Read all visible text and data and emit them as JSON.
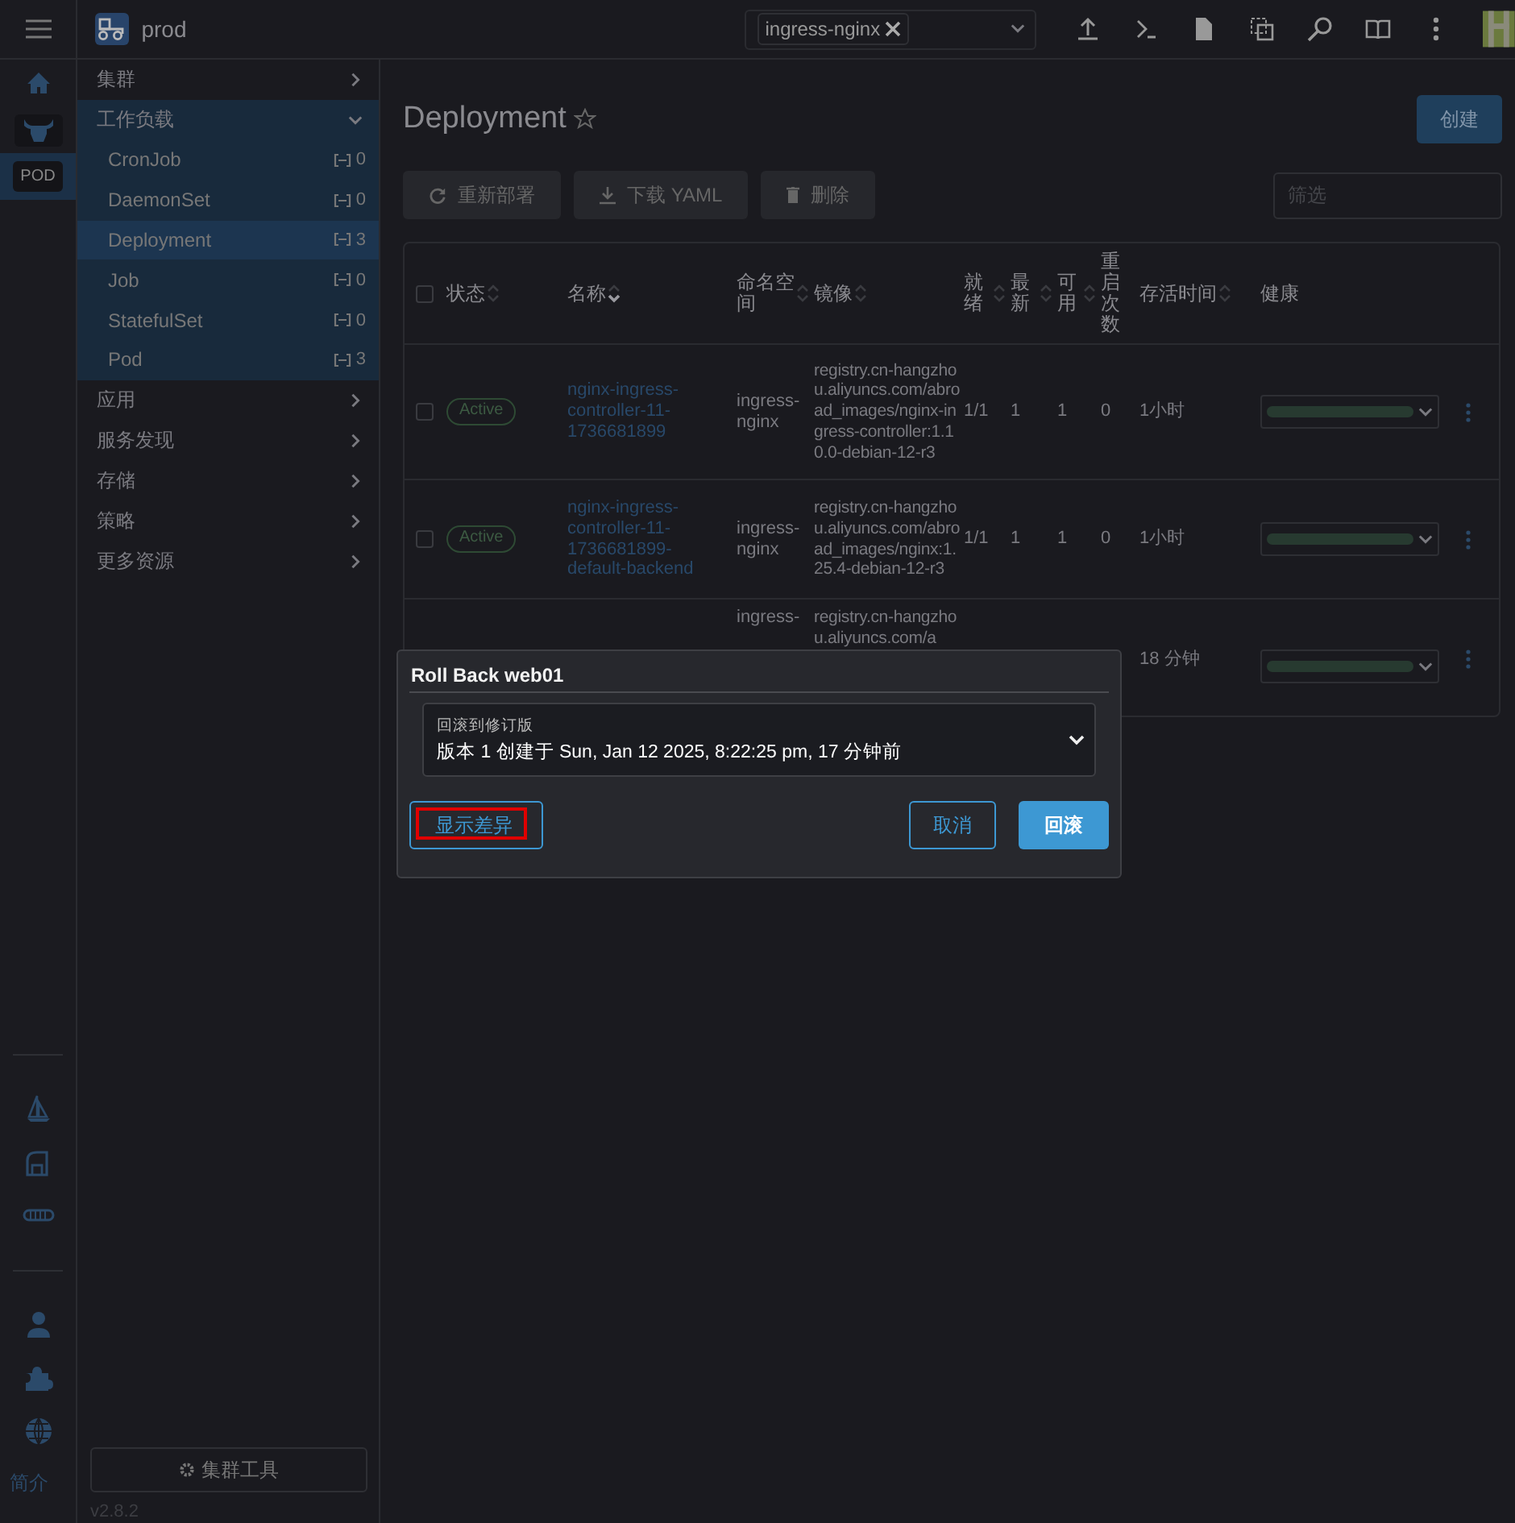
{
  "topbar": {
    "cluster": "prod",
    "namespace_chips": [
      {
        "label": "ingress-nginx"
      }
    ]
  },
  "rail": {
    "items": [
      {
        "kind": "home",
        "selected": false
      },
      {
        "kind": "cluster",
        "selected": false
      },
      {
        "kind": "pod",
        "label": "POD",
        "selected": true
      }
    ],
    "about": "简介"
  },
  "nav": {
    "groups": [
      {
        "label": "集群",
        "expanded": false
      },
      {
        "label": "工作负载",
        "expanded": true,
        "children": [
          {
            "label": "CronJob",
            "count": "0",
            "selected": false
          },
          {
            "label": "DaemonSet",
            "count": "0",
            "selected": false
          },
          {
            "label": "Deployment",
            "count": "3",
            "selected": true
          },
          {
            "label": "Job",
            "count": "0",
            "selected": false
          },
          {
            "label": "StatefulSet",
            "count": "0",
            "selected": false
          },
          {
            "label": "Pod",
            "count": "3",
            "selected": false
          }
        ]
      },
      {
        "label": "应用",
        "expanded": false
      },
      {
        "label": "服务发现",
        "expanded": false
      },
      {
        "label": "存储",
        "expanded": false
      },
      {
        "label": "策略",
        "expanded": false
      },
      {
        "label": "更多资源",
        "expanded": false
      }
    ],
    "tools_button": "集群工具",
    "version": "v2.8.2"
  },
  "page": {
    "title": "Deployment",
    "favorite": false,
    "create_button": "创建",
    "actions": [
      {
        "kind": "redeploy",
        "label": "重新部署",
        "disabled": true
      },
      {
        "kind": "download",
        "label": "下载 YAML",
        "disabled": true
      },
      {
        "kind": "delete",
        "label": "删除",
        "disabled": true
      }
    ],
    "filter": {
      "placeholder": "筛选"
    }
  },
  "table": {
    "columns": [
      {
        "label": "状态",
        "sortable": true,
        "sorted": false
      },
      {
        "label": "名称",
        "sortable": true,
        "sorted": true
      },
      {
        "label": "命名空间",
        "sortable": true,
        "sorted": false
      },
      {
        "label": "镜像",
        "sortable": true,
        "sorted": false
      },
      {
        "label": "就绪",
        "sortable": true,
        "sorted": false
      },
      {
        "label": "最新",
        "sortable": true,
        "sorted": false
      },
      {
        "label": "可用",
        "sortable": true,
        "sorted": false
      },
      {
        "label": "重启次数",
        "sortable": false
      },
      {
        "label": "存活时间",
        "sortable": true,
        "sorted": false
      },
      {
        "label": "健康",
        "sortable": false
      }
    ],
    "all_selected": false,
    "rows": [
      {
        "selected": false,
        "status": "Active",
        "name": "nginx-ingress-controller-11-1736681899",
        "namespace": "ingress-nginx",
        "image": "registry.cn-hangzhou.aliyuncs.com/abroad_images/nginx-ingress-controller:1.10.0-debian-12-r3",
        "ready": "1/1",
        "up_to_date": "1",
        "available": "1",
        "restarts": "0",
        "age": "1小时"
      },
      {
        "selected": false,
        "status": "Active",
        "name": "nginx-ingress-controller-11-1736681899-default-backend",
        "namespace": "ingress-nginx",
        "image": "registry.cn-hangzhou.aliyuncs.com/abroad_images/nginx:1.25.4-debian-12-r3",
        "ready": "1/1",
        "up_to_date": "1",
        "available": "1",
        "restarts": "0",
        "age": "1小时"
      },
      {
        "namespace": "ingress-",
        "image": "registry.cn-hangzhou.aliyuncs.com/a",
        "age": "18 分钟"
      }
    ]
  },
  "dialog": {
    "title": "Roll Back web01",
    "select": {
      "label": "回滚到修订版",
      "value": "版本 1 创建于 Sun, Jan 12 2025, 8:22:25 pm, 17 分钟前"
    },
    "buttons": [
      {
        "kind": "outline",
        "label": "显示差异",
        "annotated": true
      },
      {
        "kind": "outline",
        "label": "取消",
        "annotated": false
      },
      {
        "kind": "primary",
        "label": "回滚",
        "annotated": false
      }
    ]
  }
}
